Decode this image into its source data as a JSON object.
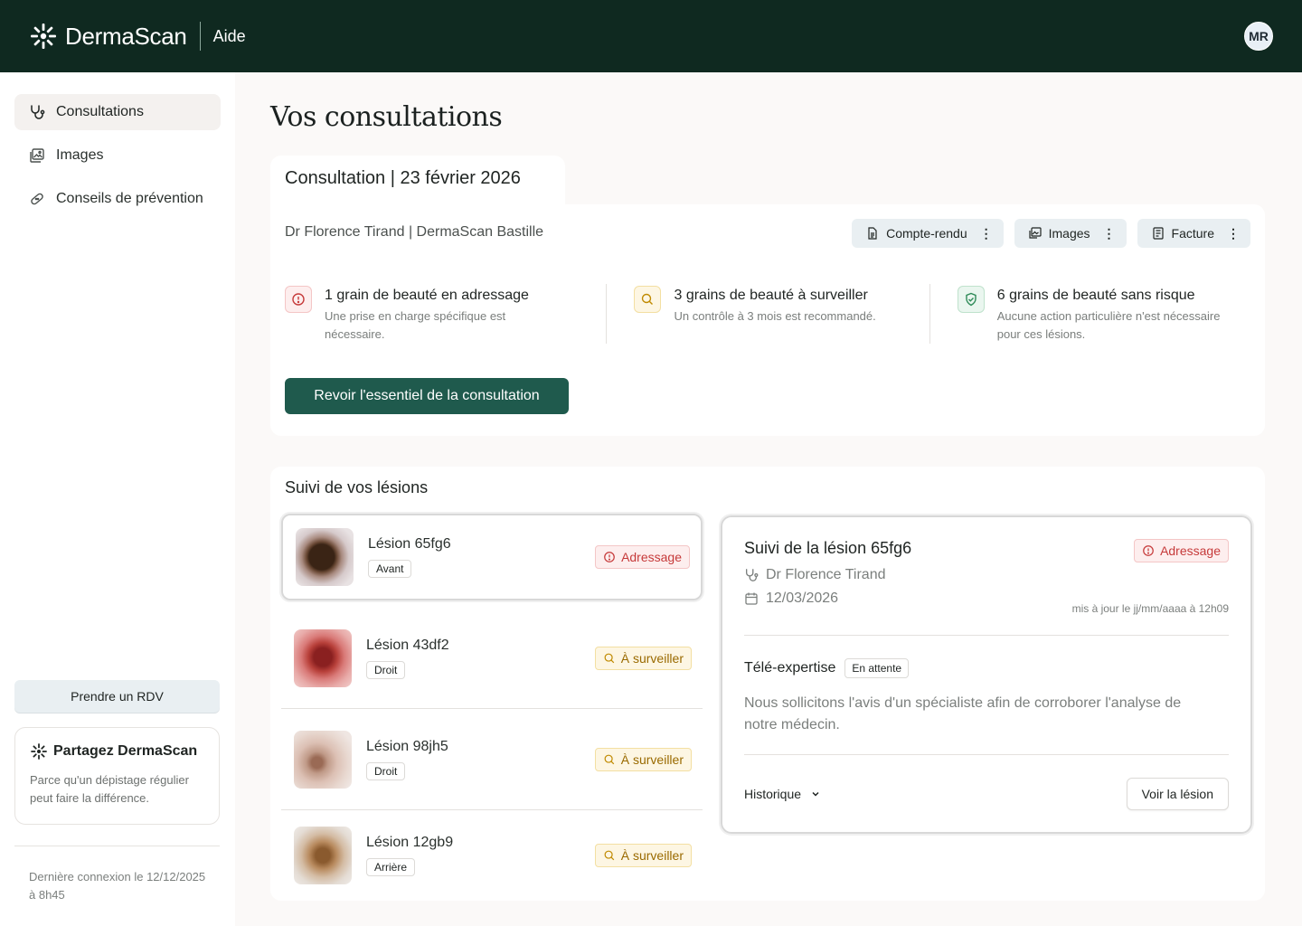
{
  "header": {
    "brand": "DermaScan",
    "help": "Aide",
    "avatar": "MR"
  },
  "sidebar": {
    "items": [
      {
        "label": "Consultations",
        "icon": "stethoscope-icon",
        "active": true
      },
      {
        "label": "Images",
        "icon": "images-icon",
        "active": false
      },
      {
        "label": "Conseils de prévention",
        "icon": "bandage-icon",
        "active": false
      }
    ],
    "rdv_button": "Prendre un RDV",
    "share": {
      "title": "Partagez DermaScan",
      "text": "Parce qu'un dépistage régulier peut faire la différence."
    },
    "last_login": "Dernière connexion le 12/12/2025 à 8h45"
  },
  "main": {
    "title": "Vos consultations",
    "consultation": {
      "tab_title": "Consultation  |  23 février 2026",
      "doctor_line": "Dr Florence Tirand  |  DermaScan Bastille",
      "actions": [
        "Compte-rendu",
        "Images",
        "Facture"
      ],
      "summary": [
        {
          "title": "1 grain de beauté en adressage",
          "desc": "Une prise en charge spécifique est nécessaire.",
          "tone": "red"
        },
        {
          "title": "3 grains de beauté à surveiller",
          "desc": "Un contrôle à 3 mois est recommandé.",
          "tone": "yellow"
        },
        {
          "title": "6 grains de beauté sans risque",
          "desc": "Aucune action particulière n'est nécessaire pour ces lésions.",
          "tone": "green"
        }
      ],
      "primary_button": "Revoir l'essentiel de la consultation"
    },
    "lesions": {
      "title": "Suivi de vos lésions",
      "items": [
        {
          "name": "Lésion 65fg6",
          "side": "Avant",
          "status": "Adressage",
          "tone": "red"
        },
        {
          "name": "Lésion 43df2",
          "side": "Droit",
          "status": "À surveiller",
          "tone": "yellow"
        },
        {
          "name": "Lésion 98jh5",
          "side": "Droit",
          "status": "À surveiller",
          "tone": "yellow"
        },
        {
          "name": "Lésion 12gb9",
          "side": "Arrière",
          "status": "À surveiller",
          "tone": "yellow"
        }
      ],
      "detail": {
        "title": "Suivi de la lésion 65fg6",
        "status": "Adressage",
        "doctor": "Dr Florence Tirand",
        "date": "12/03/2026",
        "updated": "mis à jour le jj/mm/aaaa à 12h09",
        "tele_title": "Télé-expertise",
        "tele_status": "En attente",
        "tele_text": "Nous sollicitons l'avis d'un spécialiste afin de corroborer l'analyse de notre médecin.",
        "history": "Historique",
        "view_button": "Voir la lésion"
      }
    }
  },
  "colors": {
    "header_bg": "#0f2920",
    "primary": "#1f5a4d",
    "danger": "#c63a3a",
    "warning": "#9a6a00",
    "success": "#2d8a57"
  }
}
